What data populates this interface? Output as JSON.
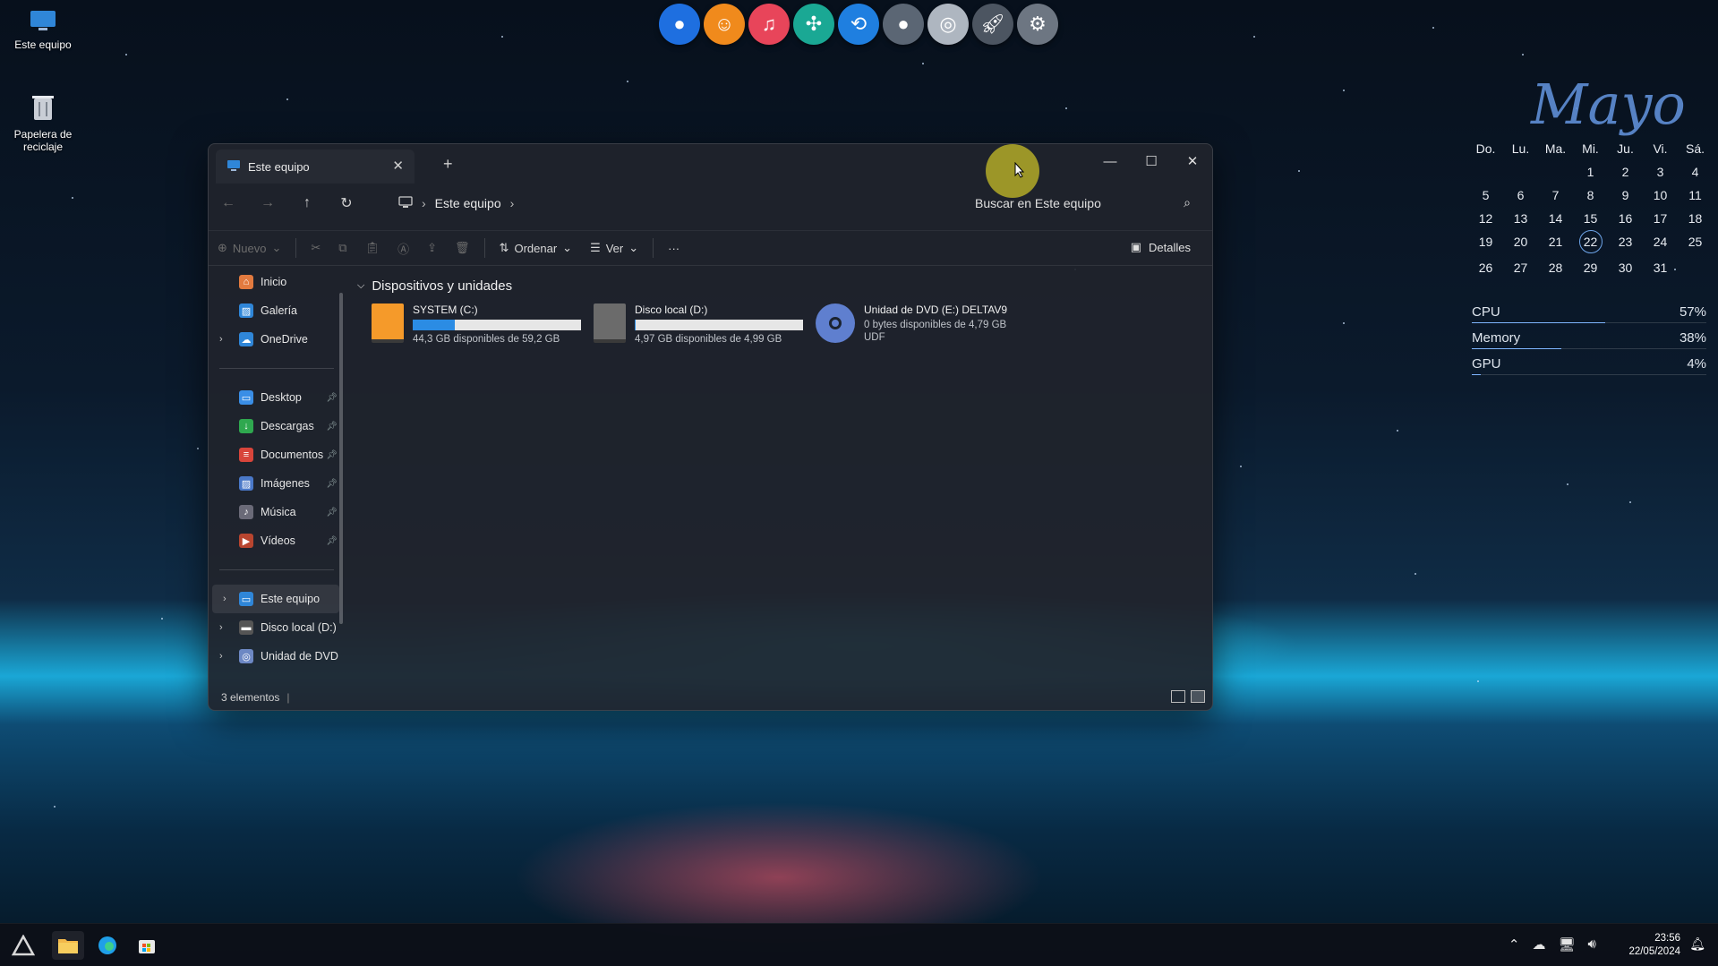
{
  "desktop": {
    "icons": [
      {
        "label": "Este equipo"
      },
      {
        "label": "Papelera de reciclaje"
      }
    ]
  },
  "dock": {
    "items": [
      "browser-icon",
      "ok-icon",
      "music-icon",
      "dots-icon",
      "share-icon",
      "drop-icon",
      "disc-icon",
      "rocket-icon",
      "settings-gear-icon"
    ]
  },
  "calendar": {
    "month": "Mayo",
    "weekdays": [
      "Do.",
      "Lu.",
      "Ma.",
      "Mi.",
      "Ju.",
      "Vi.",
      "Sá."
    ],
    "weeks": [
      [
        "",
        "",
        "",
        "1",
        "2",
        "3",
        "4"
      ],
      [
        "5",
        "6",
        "7",
        "8",
        "9",
        "10",
        "11"
      ],
      [
        "12",
        "13",
        "14",
        "15",
        "16",
        "17",
        "18"
      ],
      [
        "19",
        "20",
        "21",
        "22",
        "23",
        "24",
        "25"
      ],
      [
        "26",
        "27",
        "28",
        "29",
        "30",
        "31",
        ""
      ]
    ],
    "today": "22"
  },
  "sysmon": [
    {
      "label": "CPU",
      "value": "57%",
      "level": 0.57
    },
    {
      "label": "Memory",
      "value": "38%",
      "level": 0.38
    },
    {
      "label": "GPU",
      "value": "4%",
      "level": 0.04
    }
  ],
  "window": {
    "tab_title": "Este equipo",
    "address": "Este equipo",
    "search_placeholder": "Buscar en Este equipo",
    "toolbar": {
      "new_label": "Nuevo",
      "sort_label": "Ordenar",
      "view_label": "Ver",
      "more_label": "···",
      "details_label": "Detalles"
    },
    "sidebar": {
      "top": [
        {
          "label": "Inicio",
          "icon": "home-icon",
          "color": "#e27a3f"
        },
        {
          "label": "Galería",
          "icon": "gallery-icon",
          "color": "#2f86d8"
        },
        {
          "label": "OneDrive",
          "icon": "cloud-icon",
          "color": "#2f86d8"
        }
      ],
      "quick": [
        {
          "label": "Desktop",
          "icon": "desktop-icon",
          "color": "#3a8ee6"
        },
        {
          "label": "Descargas",
          "icon": "download-icon",
          "color": "#2fa84f"
        },
        {
          "label": "Documentos",
          "icon": "document-icon",
          "color": "#d8453b"
        },
        {
          "label": "Imágenes",
          "icon": "image-icon",
          "color": "#4a78c8"
        },
        {
          "label": "Música",
          "icon": "music-icon",
          "color": "#6a6a78"
        },
        {
          "label": "Vídeos",
          "icon": "video-icon",
          "color": "#b8452f"
        }
      ],
      "devices": [
        {
          "label": "Este equipo",
          "icon": "computer-icon",
          "color": "#2f86d8"
        },
        {
          "label": "Disco local (D:)",
          "icon": "drive-icon",
          "color": "#555"
        },
        {
          "label": "Unidad de DVD",
          "icon": "dvd-icon",
          "color": "#6d88c4"
        }
      ]
    },
    "group_header": "Dispositivos y unidades",
    "drives": [
      {
        "name": "SYSTEM (C:)",
        "sub": "44,3 GB disponibles de 59,2 GB",
        "used": 0.25,
        "color": "#f59a2a"
      },
      {
        "name": "Disco local (D:)",
        "sub": "4,97 GB disponibles de 4,99 GB",
        "used": 0.004,
        "color": "#6b6b6b"
      },
      {
        "name": "Unidad de DVD (E:) DELTAV9",
        "sub": "0 bytes disponibles de 4,79 GB",
        "sub2": "UDF",
        "color": "#5f7fcf"
      }
    ],
    "status": "3 elementos"
  },
  "taskbar": {
    "time": "23:56",
    "date": "22/05/2024"
  }
}
